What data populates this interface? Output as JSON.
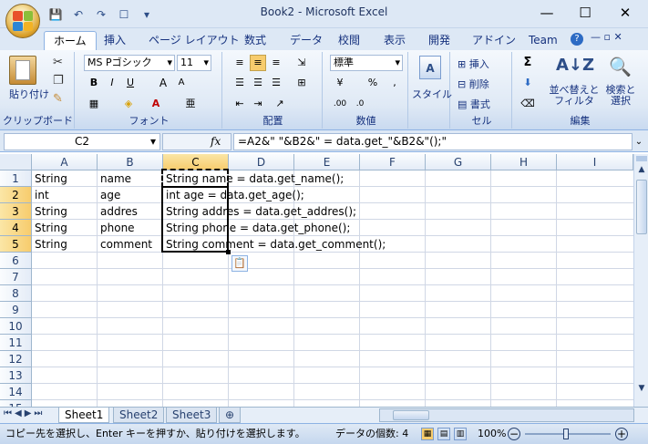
{
  "window": {
    "title": "Book2 - Microsoft Excel",
    "min": "—",
    "max": "☐",
    "close": "✕"
  },
  "qat": [
    "💾",
    "↶",
    "↷",
    "☐",
    "▾"
  ],
  "tabs": [
    "ホーム",
    "挿入",
    "ページ レイアウト",
    "数式",
    "データ",
    "校閲",
    "表示",
    "開発",
    "アドイン",
    "Team"
  ],
  "ribbon": {
    "clipboard": {
      "paste": "貼り付け",
      "label": "クリップボード"
    },
    "font": {
      "name": "MS Pゴシック",
      "size": "11",
      "label": "フォント",
      "bold": "B",
      "italic": "I",
      "underline": "U",
      "grow": "A",
      "shrink": "A"
    },
    "alignment": {
      "label": "配置"
    },
    "number": {
      "format": "標準",
      "label": "数値",
      "percent": "%",
      "comma": ","
    },
    "styles": {
      "label": "スタイル"
    },
    "cells": {
      "insert": "挿入",
      "delete": "削除",
      "format": "書式",
      "label": "セル"
    },
    "editing": {
      "sum": "Σ",
      "sort": "並べ替えと フィルタ",
      "find": "検索と 選択",
      "label": "編集"
    }
  },
  "formulabar": {
    "namebox": "C2",
    "fx": "fx",
    "formula": "=A2&\" \"&B2&\" = data.get_\"&B2&\"();\""
  },
  "columns": [
    "A",
    "B",
    "C",
    "D",
    "E",
    "F",
    "G",
    "H",
    "I"
  ],
  "rows": [
    "1",
    "2",
    "3",
    "4",
    "5",
    "6",
    "7",
    "8",
    "9",
    "10",
    "11",
    "12",
    "13",
    "14",
    "15"
  ],
  "cells": {
    "A": [
      "String",
      "int",
      "String",
      "String",
      "String"
    ],
    "B": [
      "name",
      "age",
      "addres",
      "phone",
      "comment"
    ],
    "C": [
      "String name = data.get_name();",
      "int age = data.get_age();",
      "String addres = data.get_addres();",
      "String phone = data.get_phone();",
      "String comment = data.get_comment();"
    ]
  },
  "sheets": [
    "Sheet1",
    "Sheet2",
    "Sheet3"
  ],
  "status": {
    "message": "コピー先を選択し、Enter キーを押すか、貼り付けを選択します。",
    "count": "データの個数: 4",
    "zoom": "100%"
  },
  "colors": {
    "accent": "#f7cc6d",
    "ribbon": "#dfe9f5",
    "grid": "#d0d7e5"
  }
}
